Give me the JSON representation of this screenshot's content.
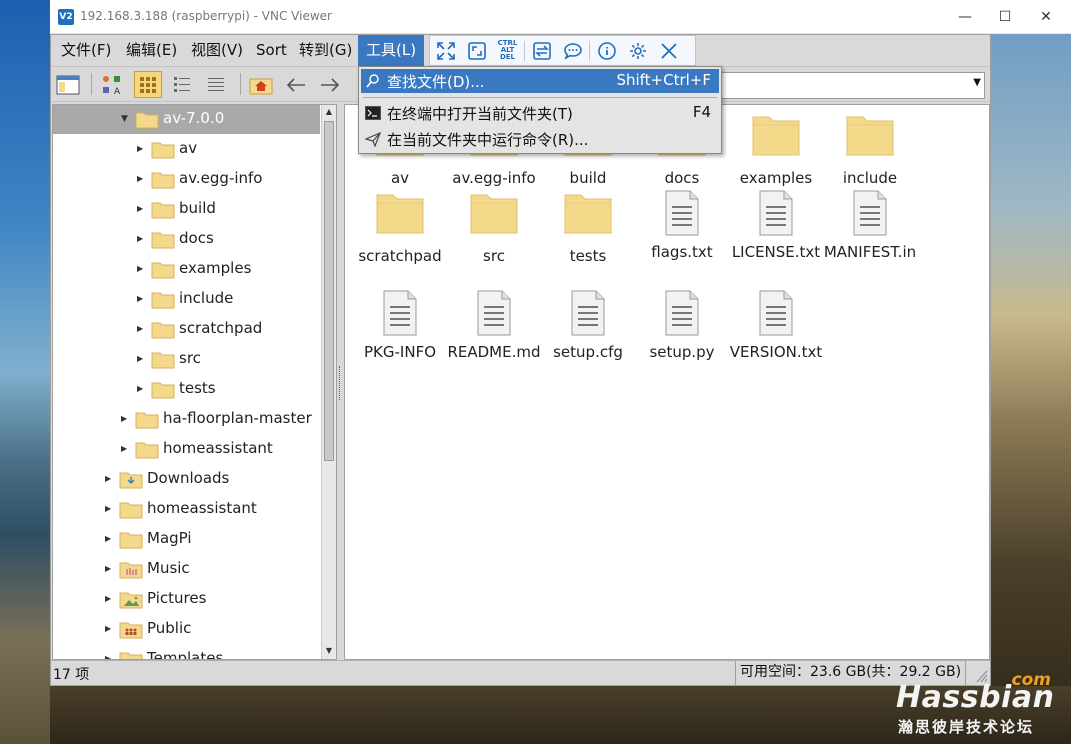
{
  "vnc": {
    "logo": "V2",
    "title": "192.168.3.188 (raspberrypi) - VNC Viewer",
    "minimize": "—",
    "maximize": "☐",
    "close": "✕"
  },
  "menubar": {
    "file": "文件(F)",
    "edit": "编辑(E)",
    "view": "视图(V)",
    "sort": "Sort",
    "go": "转到(G)",
    "tools": "工具(L)"
  },
  "vnc_toolbar": {
    "icons": [
      "fullscreen-icon",
      "scale-icon",
      "ctrl-alt-del-icon",
      "transfer-icon",
      "chat-icon",
      "info-icon",
      "settings-icon",
      "close-icon"
    ],
    "cad_text": [
      "CTRL",
      "ALT",
      "DEL"
    ]
  },
  "tools_menu": {
    "items": [
      {
        "label": "查找文件(D)...",
        "shortcut": "Shift+Ctrl+F",
        "icon": "search-icon"
      },
      {
        "label": "在终端中打开当前文件夹(T)",
        "shortcut": "F4",
        "icon": "terminal-icon"
      },
      {
        "label": "在当前文件夹中运行命令(R)...",
        "shortcut": "",
        "icon": "send-icon"
      }
    ]
  },
  "tree": {
    "items": [
      {
        "label": "av-7.0.0",
        "expanded": true,
        "selected": true,
        "icon": "folder-icon"
      },
      {
        "label": "av",
        "icon": "folder-icon"
      },
      {
        "label": "av.egg-info",
        "icon": "folder-icon"
      },
      {
        "label": "build",
        "icon": "folder-icon"
      },
      {
        "label": "docs",
        "icon": "folder-icon"
      },
      {
        "label": "examples",
        "icon": "folder-icon"
      },
      {
        "label": "include",
        "icon": "folder-icon"
      },
      {
        "label": "scratchpad",
        "icon": "folder-icon"
      },
      {
        "label": "src",
        "icon": "folder-icon"
      },
      {
        "label": "tests",
        "icon": "folder-icon"
      },
      {
        "label": "ha-floorplan-master",
        "icon": "folder-icon"
      },
      {
        "label": "homeassistant",
        "icon": "folder-icon"
      },
      {
        "label": "Downloads",
        "icon": "downloads-folder-icon"
      },
      {
        "label": "homeassistant",
        "icon": "folder-icon"
      },
      {
        "label": "MagPi",
        "icon": "folder-icon"
      },
      {
        "label": "Music",
        "icon": "music-folder-icon"
      },
      {
        "label": "Pictures",
        "icon": "pictures-folder-icon"
      },
      {
        "label": "Public",
        "icon": "public-folder-icon"
      },
      {
        "label": "Templates",
        "icon": "templates-folder-icon"
      }
    ]
  },
  "files": [
    {
      "name": "av",
      "type": "folder"
    },
    {
      "name": "av.egg-info",
      "type": "folder"
    },
    {
      "name": "build",
      "type": "folder"
    },
    {
      "name": "docs",
      "type": "folder"
    },
    {
      "name": "examples",
      "type": "folder"
    },
    {
      "name": "include",
      "type": "folder"
    },
    {
      "name": "scratchpad",
      "type": "folder"
    },
    {
      "name": "src",
      "type": "folder"
    },
    {
      "name": "tests",
      "type": "folder"
    },
    {
      "name": "flags.txt",
      "type": "text"
    },
    {
      "name": "LICENSE.txt",
      "type": "text"
    },
    {
      "name": "MANIFEST.in",
      "type": "text"
    },
    {
      "name": "PKG-INFO",
      "type": "text"
    },
    {
      "name": "README.md",
      "type": "text"
    },
    {
      "name": "setup.cfg",
      "type": "text"
    },
    {
      "name": "setup.py",
      "type": "text"
    },
    {
      "name": "VERSION.txt",
      "type": "text"
    }
  ],
  "status": {
    "count": "17 项",
    "space": "可用空间：23.6 GB(共：29.2 GB)"
  },
  "watermark": {
    "com": "com",
    "brand": "Hassbian",
    "sub": "瀚思彼岸技术论坛"
  },
  "colors": {
    "selection": "#3a78c2",
    "folder": "#f5d98b",
    "vnc_accent": "#1f6fc1"
  }
}
